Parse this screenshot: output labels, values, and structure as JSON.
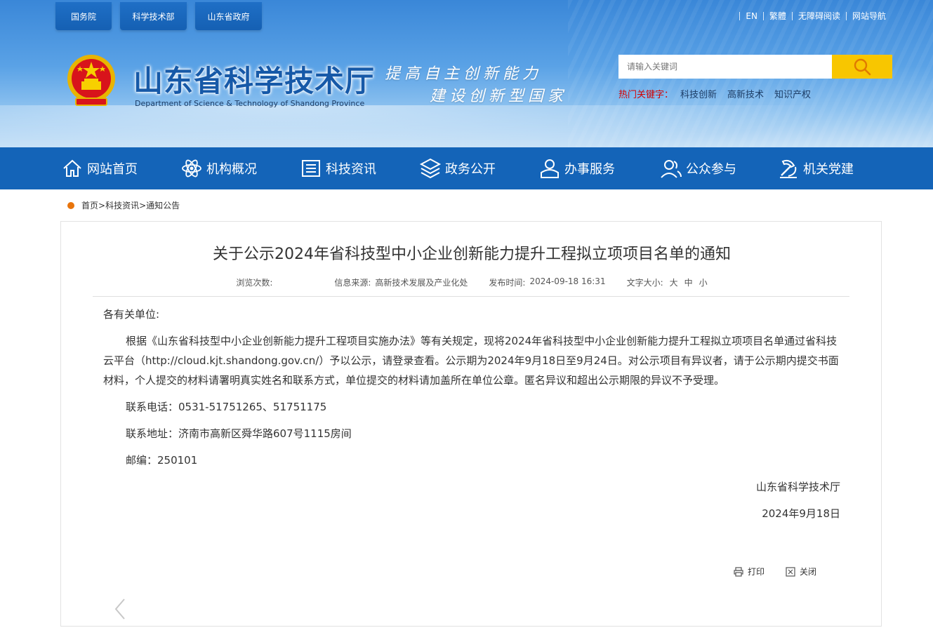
{
  "top_links": [
    "国务院",
    "科学技术部",
    "山东省政府"
  ],
  "util_links": [
    "EN",
    "繁體",
    "无障碍阅读",
    "网站导航"
  ],
  "site": {
    "title": "山东省科学技术厅",
    "subtitle": "Department of Science & Technology of Shandong Province",
    "slogan_line1": "提高自主创新能力",
    "slogan_line2": "建设创新型国家"
  },
  "search": {
    "placeholder": "请输入关键词",
    "hot_label": "热门关键字：",
    "hot_keywords": [
      "科技创新",
      "高新技术",
      "知识产权"
    ]
  },
  "colors": {
    "nav_bg": "#1464b8",
    "search_btn": "#f8c600",
    "hot_label": "#d40000",
    "crumb_dot": "#e8740c"
  },
  "nav": [
    {
      "label": "网站首页",
      "icon": "home-icon"
    },
    {
      "label": "机构概况",
      "icon": "atom-icon"
    },
    {
      "label": "科技资讯",
      "icon": "news-icon"
    },
    {
      "label": "政务公开",
      "icon": "layers-icon"
    },
    {
      "label": "办事服务",
      "icon": "user-service-icon"
    },
    {
      "label": "公众参与",
      "icon": "people-icon"
    },
    {
      "label": "机关党建",
      "icon": "party-icon"
    }
  ],
  "breadcrumb": [
    "首页",
    "科技资讯",
    "通知公告"
  ],
  "article": {
    "title": "关于公示2024年省科技型中小企业创新能力提升工程拟立项项目名单的通知",
    "meta": {
      "views_label": "浏览次数:",
      "source_label": "信息来源:",
      "source": "高新技术发展及产业化处",
      "time_label": "发布时间:",
      "time": "2024-09-18 16:31",
      "font_label": "文字大小:",
      "font_sizes": [
        "大",
        "中",
        "小"
      ]
    },
    "salutation": "各有关单位:",
    "paragraph": "根据《山东省科技型中小企业创新能力提升工程项目实施办法》等有关规定，现将2024年省科技型中小企业创新能力提升工程拟立项项目名单通过省科技云平台（http://cloud.kjt.shandong.gov.cn/）予以公示，请登录查看。公示期为2024年9月18日至9月24日。对公示项目有异议者，请于公示期内提交书面材料，个人提交的材料请署明真实姓名和联系方式，单位提交的材料请加盖所在单位公章。匿名异议和超出公示期限的异议不予受理。",
    "phone": "联系电话：0531-51751265、51751175",
    "address": "联系地址：济南市高新区舜华路607号1115房间",
    "postcode": "邮编：250101",
    "signature": "山东省科学技术厅",
    "date": "2024年9月18日"
  },
  "tools": {
    "print": "打印",
    "close": "关闭"
  }
}
